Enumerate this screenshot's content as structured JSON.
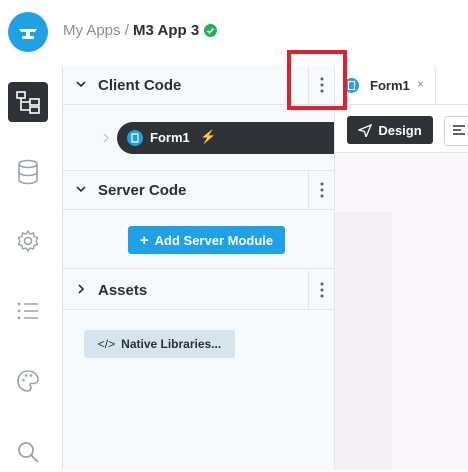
{
  "breadcrumb": {
    "parent": "My Apps",
    "separator": " / ",
    "app_name": "M3 App 3"
  },
  "sidebar_rail": [
    {
      "icon": "app-tree-icon",
      "active": true
    },
    {
      "icon": "database-icon",
      "active": false
    },
    {
      "icon": "settings-icon",
      "active": false
    },
    {
      "icon": "list-icon",
      "active": false
    },
    {
      "icon": "palette-icon",
      "active": false
    },
    {
      "icon": "search-icon",
      "active": false
    }
  ],
  "panel": {
    "client_code": {
      "title": "Client Code",
      "items": [
        {
          "label": "Form1"
        }
      ]
    },
    "server_code": {
      "title": "Server Code",
      "add_label": "Add Server Module"
    },
    "assets": {
      "title": "Assets",
      "native_label": "Native Libraries..."
    }
  },
  "editor": {
    "tab": {
      "label": "Form1",
      "close": "×"
    },
    "design_label": "Design"
  },
  "colors": {
    "accent": "#1ea1e6",
    "dark": "#2f3237",
    "success": "#20b15a",
    "highlight": "#e0202a"
  }
}
